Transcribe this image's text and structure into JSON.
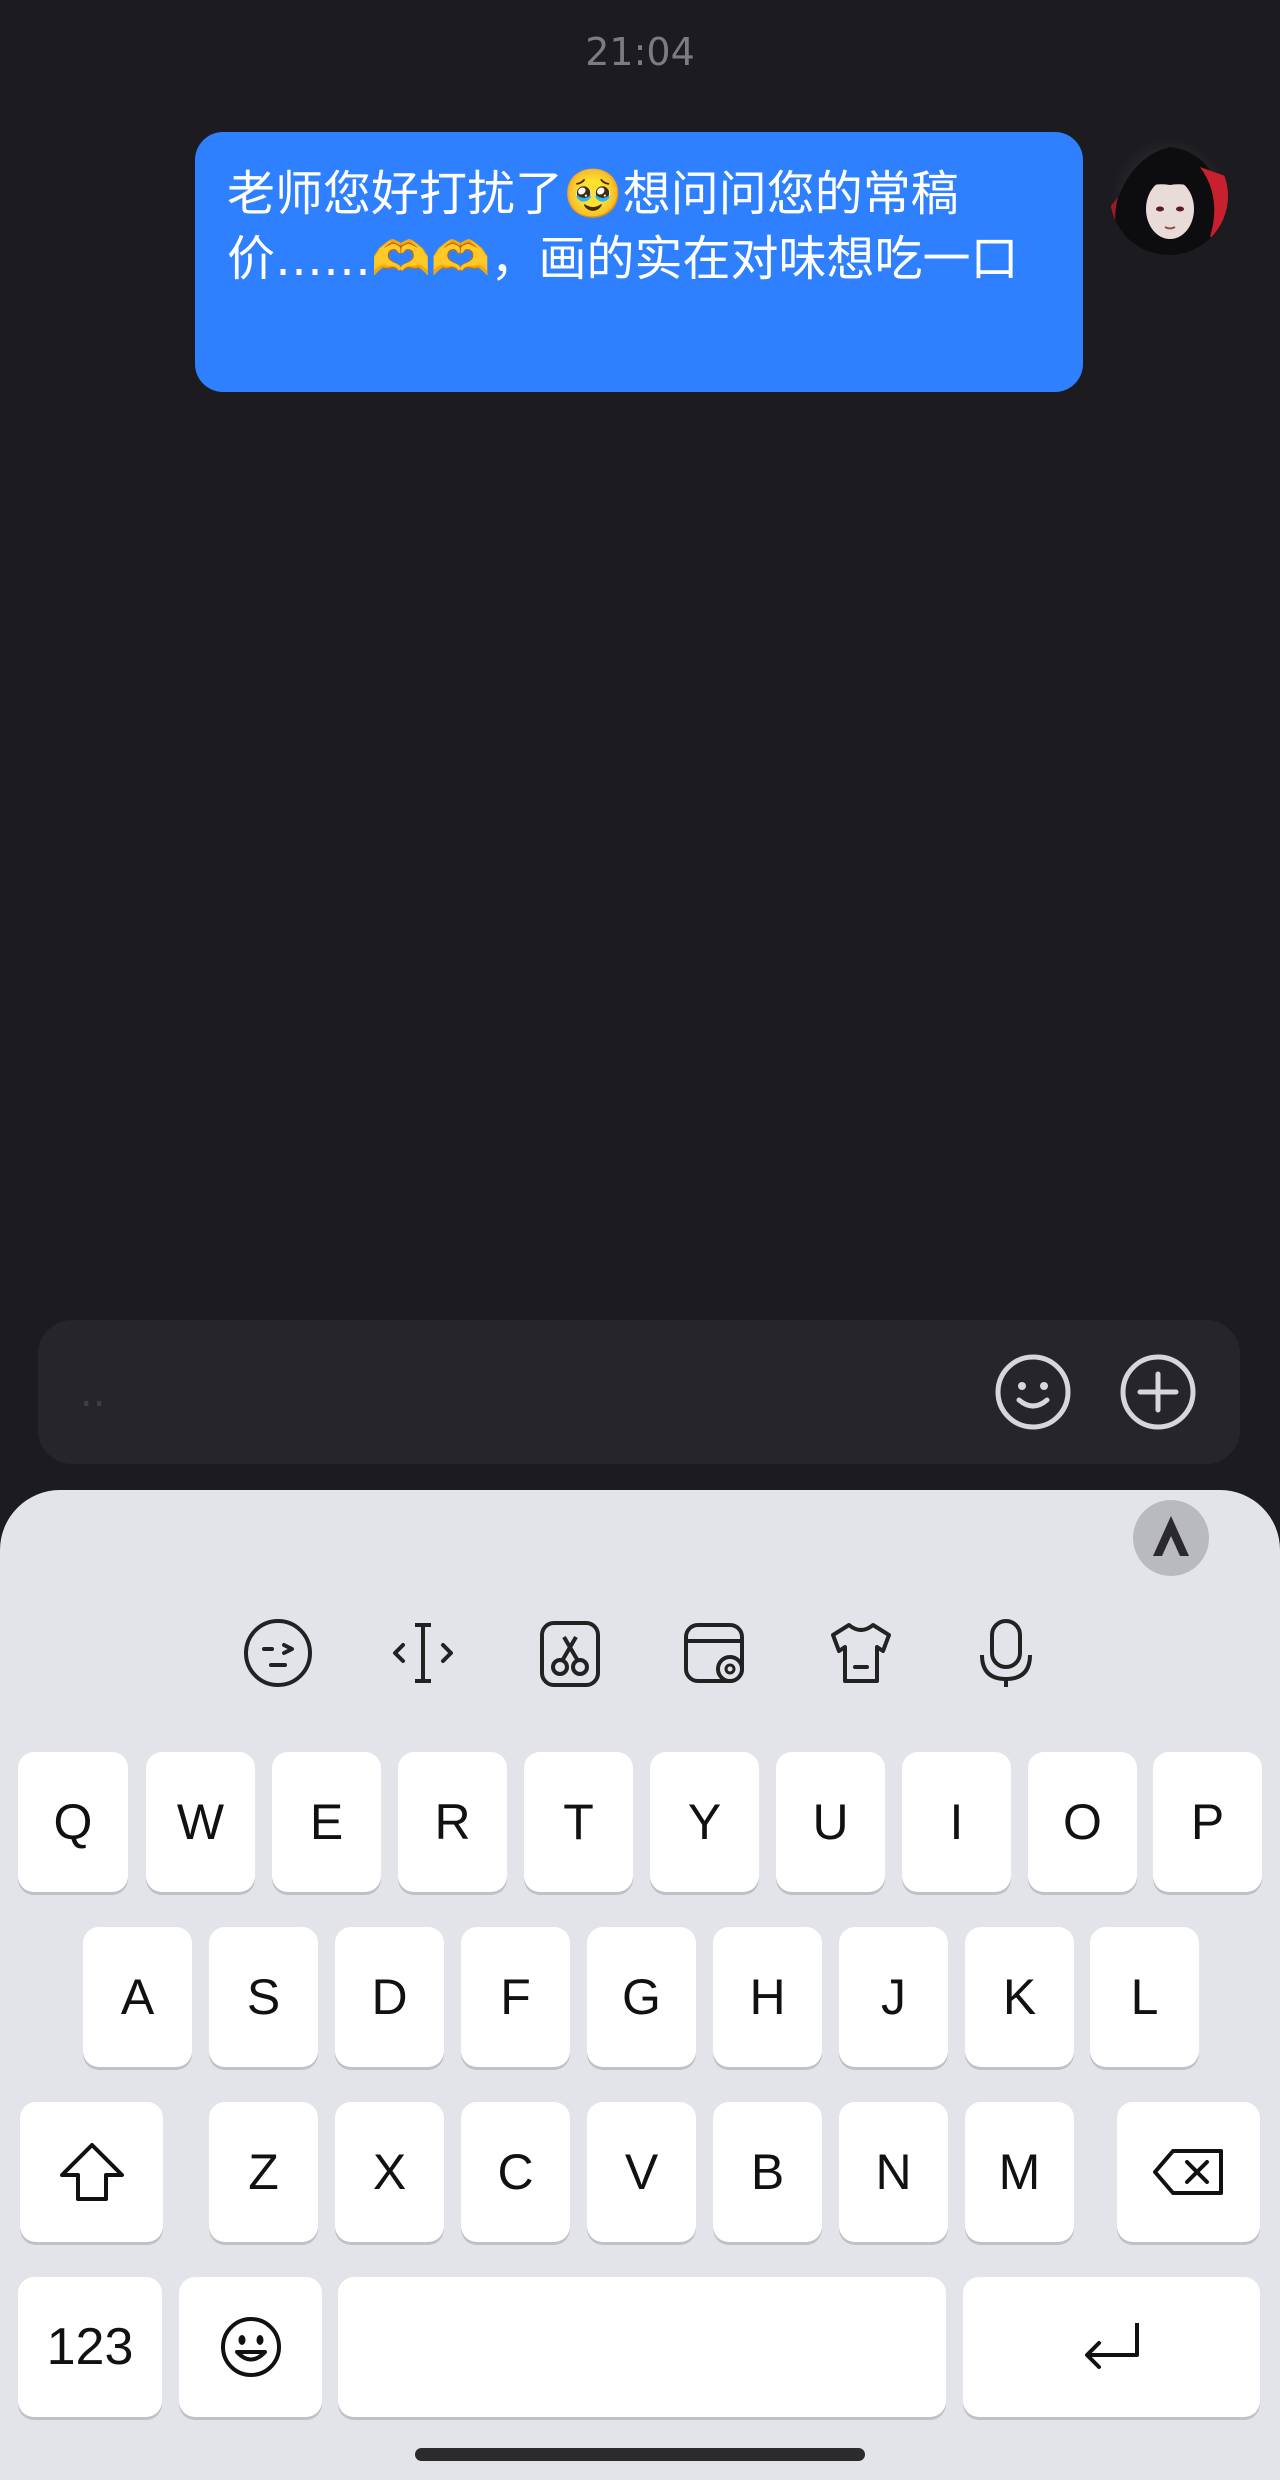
{
  "chat": {
    "timestamp": "21:04",
    "message": "老师您好打扰了🥹想问问您的常稿价……🫶🫶，画的实在对味想吃一口"
  },
  "input_bar": {
    "placeholder": "..",
    "emoji_icon": "smile-icon",
    "plus_icon": "plus-circle-icon"
  },
  "keyboard": {
    "toolbar_icons": [
      "emoji-face-icon",
      "cursor-icon",
      "clipboard-scissors-icon",
      "wallet-settings-icon",
      "shirt-skin-icon",
      "microphone-icon"
    ],
    "row1": [
      "Q",
      "W",
      "E",
      "R",
      "T",
      "Y",
      "U",
      "I",
      "O",
      "P"
    ],
    "row2": [
      "A",
      "S",
      "D",
      "F",
      "G",
      "H",
      "J",
      "K",
      "L"
    ],
    "row3": [
      "Z",
      "X",
      "C",
      "V",
      "B",
      "N",
      "M"
    ],
    "numbers_label": "123",
    "shift_icon": "shift-arrow-icon",
    "backspace_icon": "backspace-icon",
    "emoji_key_icon": "emoji-key-icon",
    "return_icon": "return-arrow-icon"
  }
}
